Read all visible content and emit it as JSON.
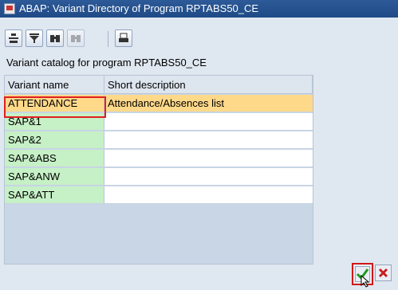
{
  "window": {
    "title": "ABAP: Variant Directory of Program RPTABS50_CE"
  },
  "toolbar": {
    "buttons": [
      {
        "icon": "details-icon"
      },
      {
        "icon": "filter-icon"
      },
      {
        "icon": "find-icon"
      },
      {
        "icon": "find-next-icon"
      },
      {
        "icon": "print-icon"
      }
    ]
  },
  "caption": "Variant catalog for program RPTABS50_CE",
  "table": {
    "columns": [
      "Variant name",
      "Short description"
    ],
    "rows": [
      {
        "name": "ATTENDANCE",
        "desc": "Attendance/Absences list",
        "selected": true
      },
      {
        "name": "SAP&1",
        "desc": ""
      },
      {
        "name": "SAP&2",
        "desc": ""
      },
      {
        "name": "SAP&ABS",
        "desc": ""
      },
      {
        "name": "SAP&ANW",
        "desc": ""
      },
      {
        "name": "SAP&ATT",
        "desc": ""
      }
    ]
  },
  "footer": {
    "confirm_icon": "checkmark-icon",
    "cancel_icon": "close-icon"
  },
  "colors": {
    "titlebar": "#1f4a86",
    "selected_row": "#ffd98a",
    "key_column": "#c6f0c6",
    "highlight": "#e02020"
  }
}
